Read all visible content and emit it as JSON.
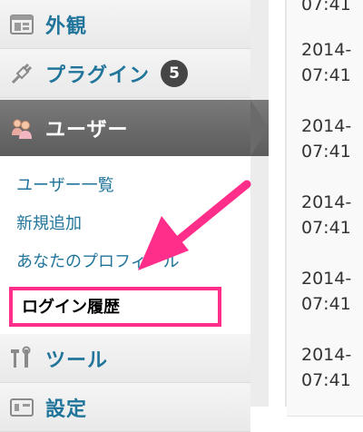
{
  "sidebar": {
    "items": [
      {
        "label": "外観",
        "icon": "appearance-icon"
      },
      {
        "label": "プラグイン",
        "icon": "plugin-icon",
        "badge": "5"
      },
      {
        "label": "ユーザー",
        "icon": "users-icon",
        "active": true
      },
      {
        "label": "ツール",
        "icon": "tools-icon"
      },
      {
        "label": "設定",
        "icon": "settings-icon"
      }
    ],
    "users_submenu": [
      {
        "label": "ユーザー一覧"
      },
      {
        "label": "新規追加"
      },
      {
        "label": "あなたのプロフィール"
      },
      {
        "label": "ログイン履歴",
        "highlighted": true
      }
    ]
  },
  "content": {
    "rows": [
      {
        "line1": "",
        "line2": "07:41"
      },
      {
        "line1": "2014-",
        "line2": "07:41"
      },
      {
        "line1": "2014-",
        "line2": "07:41"
      },
      {
        "line1": "2014-",
        "line2": "07:41"
      },
      {
        "line1": "2014-",
        "line2": "07:41"
      },
      {
        "line1": "2014-",
        "line2": "07:41"
      }
    ]
  },
  "colors": {
    "link": "#21759b",
    "active_bg": "#6a6a6a",
    "highlight": "#ff2e8a",
    "badge": "#464646"
  }
}
